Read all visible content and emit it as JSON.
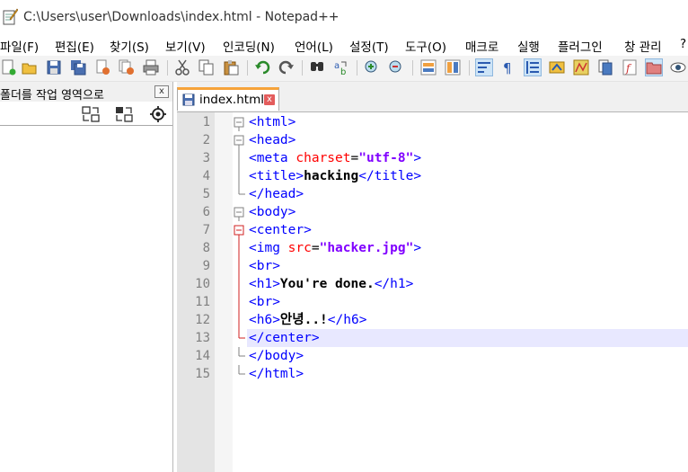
{
  "window": {
    "title": "C:\\Users\\user\\Downloads\\index.html - Notepad++",
    "icon": "notepad-icon"
  },
  "menu": {
    "items": [
      {
        "label": "파일(F)"
      },
      {
        "label": "편집(E)"
      },
      {
        "label": "찾기(S)"
      },
      {
        "label": "보기(V)"
      },
      {
        "label": "인코딩(N)"
      },
      {
        "label": "언어(L)"
      },
      {
        "label": "설정(T)"
      },
      {
        "label": "도구(O)"
      },
      {
        "label": "매크로"
      },
      {
        "label": "실행"
      },
      {
        "label": "플러그인"
      },
      {
        "label": "창 관리"
      },
      {
        "label": "?"
      }
    ]
  },
  "toolbar": {
    "buttons": [
      {
        "icon": "new-file-icon"
      },
      {
        "icon": "open-file-icon"
      },
      {
        "icon": "save-icon"
      },
      {
        "icon": "save-all-icon"
      },
      {
        "icon": "close-icon"
      },
      {
        "icon": "close-all-icon"
      },
      {
        "icon": "print-icon"
      },
      {
        "icon": "cut-icon"
      },
      {
        "icon": "copy-icon"
      },
      {
        "icon": "paste-icon"
      },
      {
        "icon": "undo-icon"
      },
      {
        "icon": "redo-icon"
      },
      {
        "icon": "find-icon"
      },
      {
        "icon": "replace-icon"
      },
      {
        "icon": "zoom-in-icon"
      },
      {
        "icon": "zoom-out-icon"
      },
      {
        "icon": "sync-vertical-icon"
      },
      {
        "icon": "sync-horizontal-icon"
      },
      {
        "icon": "word-wrap-icon"
      },
      {
        "icon": "show-all-chars-icon"
      },
      {
        "icon": "indent-guide-icon"
      },
      {
        "icon": "udl-icon"
      },
      {
        "icon": "doc-map-icon"
      },
      {
        "icon": "doc-list-icon"
      },
      {
        "icon": "function-list-icon"
      },
      {
        "icon": "folder-workspace-icon"
      },
      {
        "icon": "monitoring-icon"
      }
    ]
  },
  "panel": {
    "title": "폴더를 작업 영역으로",
    "close_label": "x",
    "tools": [
      {
        "icon": "collapse-all-icon"
      },
      {
        "icon": "expand-all-icon"
      },
      {
        "icon": "locate-icon"
      }
    ]
  },
  "tab": {
    "label": "index.html",
    "close_label": "x"
  },
  "editor": {
    "current_line": 13,
    "lines": [
      {
        "n": "1",
        "fold": "minus"
      },
      {
        "n": "2",
        "fold": "minus"
      },
      {
        "n": "3",
        "fold": "line"
      },
      {
        "n": "4",
        "fold": "line"
      },
      {
        "n": "5",
        "fold": "end"
      },
      {
        "n": "6",
        "fold": "minus"
      },
      {
        "n": "7",
        "fold": "minus-red"
      },
      {
        "n": "8",
        "fold": "line-red"
      },
      {
        "n": "9",
        "fold": "line-red"
      },
      {
        "n": "10",
        "fold": "line-red"
      },
      {
        "n": "11",
        "fold": "line-red"
      },
      {
        "n": "12",
        "fold": "line-red"
      },
      {
        "n": "13",
        "fold": "end-red"
      },
      {
        "n": "14",
        "fold": "end"
      },
      {
        "n": "15",
        "fold": "end"
      }
    ],
    "tokens": [
      [
        {
          "c": "tag",
          "t": "<html>"
        }
      ],
      [
        {
          "c": "tag",
          "t": "<head>"
        }
      ],
      [
        {
          "c": "tag",
          "t": "<meta "
        },
        {
          "c": "attr",
          "t": "charset"
        },
        {
          "c": "eq",
          "t": "="
        },
        {
          "c": "val",
          "t": "\"utf-8\""
        },
        {
          "c": "tag",
          "t": ">"
        }
      ],
      [
        {
          "c": "tag",
          "t": "<title>"
        },
        {
          "c": "txt",
          "t": "hacking"
        },
        {
          "c": "tag",
          "t": "</title>"
        }
      ],
      [
        {
          "c": "tag",
          "t": "</head>"
        }
      ],
      [
        {
          "c": "tag",
          "t": "<body>"
        }
      ],
      [
        {
          "c": "tag",
          "t": "<center>"
        }
      ],
      [
        {
          "c": "tag",
          "t": "<img "
        },
        {
          "c": "attr",
          "t": "src"
        },
        {
          "c": "eq",
          "t": "="
        },
        {
          "c": "val",
          "t": "\"hacker.jpg\""
        },
        {
          "c": "tag",
          "t": ">"
        }
      ],
      [
        {
          "c": "tag",
          "t": "<br>"
        }
      ],
      [
        {
          "c": "tag",
          "t": "<h1>"
        },
        {
          "c": "txt",
          "t": "You're done."
        },
        {
          "c": "tag",
          "t": "</h1>"
        }
      ],
      [
        {
          "c": "tag",
          "t": "<br>"
        }
      ],
      [
        {
          "c": "tag",
          "t": "<h6>"
        },
        {
          "c": "txt",
          "t": "안녕..!"
        },
        {
          "c": "tag",
          "t": "</h6>"
        }
      ],
      [
        {
          "c": "tag",
          "t": "</center>"
        }
      ],
      [
        {
          "c": "tag",
          "t": "</body>"
        }
      ],
      [
        {
          "c": "tag",
          "t": "</html>"
        }
      ]
    ]
  },
  "colors": {
    "tag": "#0000ff",
    "attr": "#ff0000",
    "value": "#8000ff",
    "current_line": "#e8e8ff",
    "tab_accent": "#f6a33a"
  }
}
